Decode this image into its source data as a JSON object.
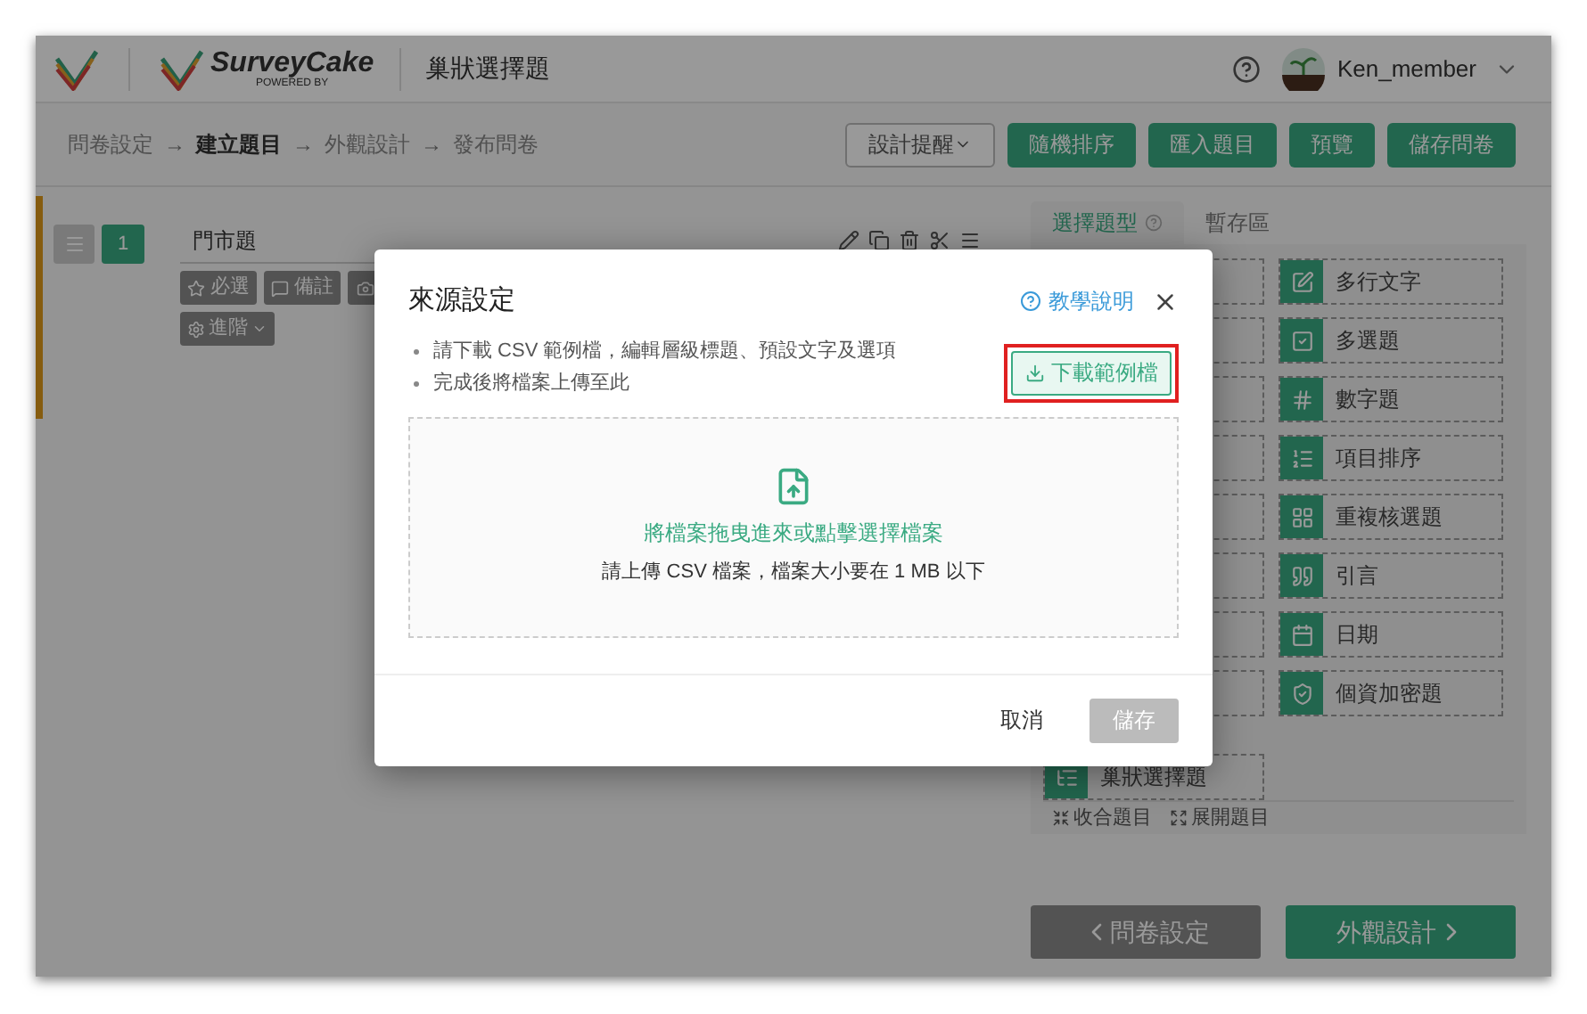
{
  "header": {
    "product": "SurveyCake",
    "powered": "POWERED BY",
    "title": "巢狀選擇題",
    "user": "Ken_member"
  },
  "steps": [
    {
      "label": "問卷設定",
      "selected": false
    },
    {
      "label": "建立題目",
      "selected": true
    },
    {
      "label": "外觀設計",
      "selected": false
    },
    {
      "label": "發布問卷",
      "selected": false
    }
  ],
  "step_separator": "→",
  "toolbar": {
    "design_tip": "設計提醒",
    "buttons": [
      "隨機排序",
      "匯入題目",
      "預覽",
      "儲存問卷"
    ]
  },
  "question": {
    "number": "1",
    "title": "門市題",
    "tags": [
      "必選",
      "備註"
    ],
    "advanced": "進階"
  },
  "panel": {
    "tabs": [
      {
        "label": "選擇題型",
        "selected": true
      },
      {
        "label": "暫存區",
        "selected": false
      }
    ],
    "types": [
      "多行文字",
      "多選題",
      "數字題",
      "項目排序",
      "重複核選題",
      "引言",
      "日期",
      "個資加密題"
    ],
    "nested_item": "巢狀選擇題",
    "collapse": "收合題目",
    "expand": "展開題目",
    "prev": "問卷設定",
    "next": "外觀設計"
  },
  "modal": {
    "title": "來源設定",
    "help": "教學說明",
    "bullets": [
      "請下載 CSV 範例檔，編輯層級標題、預設文字及選項",
      "完成後將檔案上傳至此"
    ],
    "download": {
      "label": "下載範例檔",
      "highlighted": true
    },
    "drop_title": "將檔案拖曳進來或點擊選擇檔案",
    "drop_hint": "請上傳 CSV 檔案，檔案大小要在 1 MB 以下",
    "cancel": "取消",
    "save": {
      "label": "儲存",
      "disabled": true
    }
  }
}
